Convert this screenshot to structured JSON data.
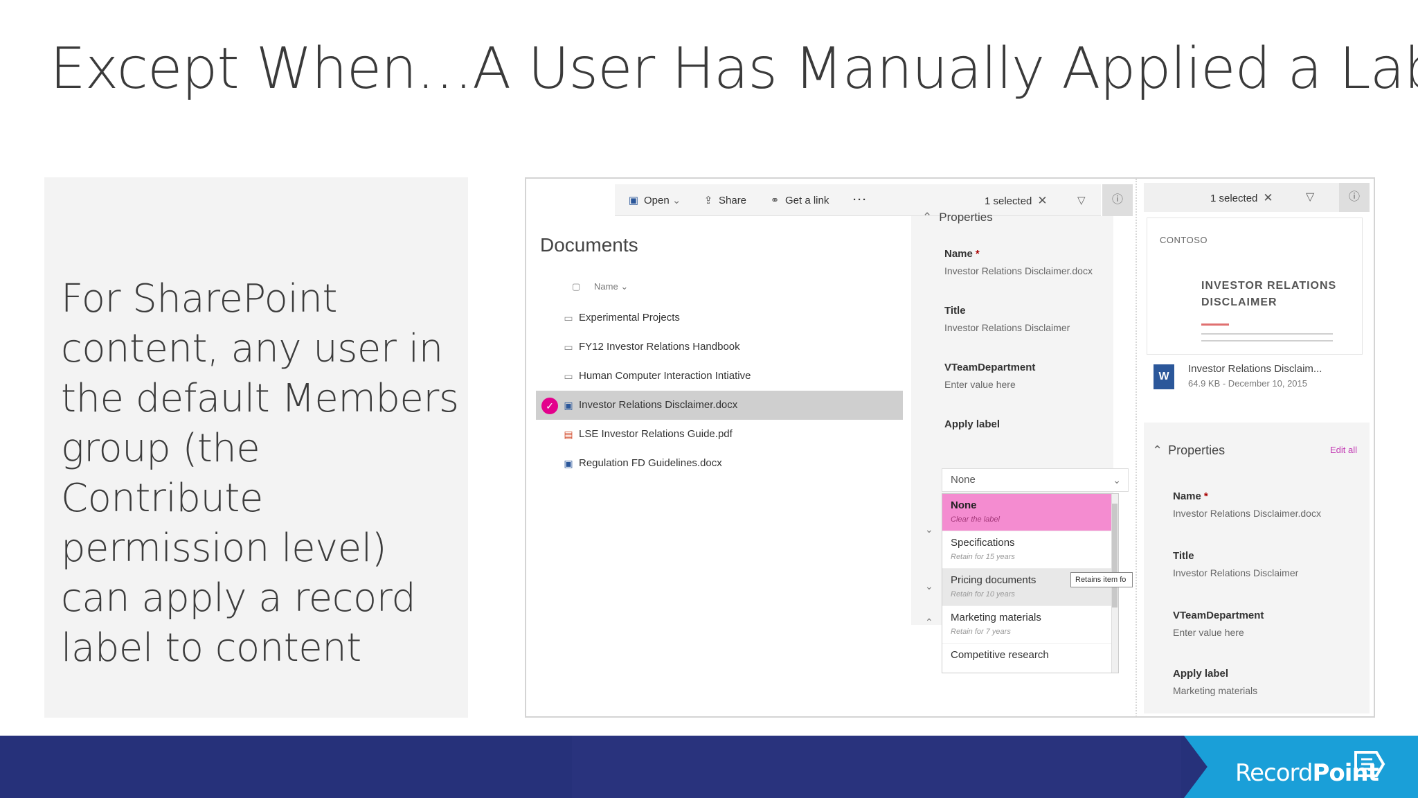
{
  "slide": {
    "title": "Except When…A User Has Manually Applied a Label",
    "body": "For SharePoint content, any user in the default Members group (the Contribute permission level) can apply a record label to content"
  },
  "library": {
    "commands": {
      "open": "Open",
      "share": "Share",
      "get_link": "Get a link",
      "more": "···",
      "selected": "1 selected"
    },
    "title": "Documents",
    "column_name": "Name",
    "rows": [
      {
        "name": "Experimental Projects",
        "kind": "folder"
      },
      {
        "name": "FY12 Investor Relations Handbook",
        "kind": "folder"
      },
      {
        "name": "Human Computer Interaction Intiative",
        "kind": "folder"
      },
      {
        "name": "Investor Relations Disclaimer.docx",
        "kind": "word",
        "selected": true
      },
      {
        "name": "LSE Investor Relations Guide.pdf",
        "kind": "pdf"
      },
      {
        "name": "Regulation FD Guidelines.docx",
        "kind": "word"
      }
    ]
  },
  "properties_pane": {
    "header": "Properties",
    "name_label": "Name",
    "name_value": "Investor Relations Disclaimer.docx",
    "title_label": "Title",
    "title_value": "Investor Relations Disclaimer",
    "dept_label": "VTeamDepartment",
    "dept_placeholder": "Enter value here",
    "apply_label": "Apply label",
    "apply_value": "None",
    "options": [
      {
        "title": "None",
        "sub": "Clear the label"
      },
      {
        "title": "Specifications",
        "sub": "Retain for 15 years"
      },
      {
        "title": "Pricing documents",
        "sub": "Retain for 10 years"
      },
      {
        "title": "Marketing materials",
        "sub": "Retain for 7 years"
      },
      {
        "title": "Competitive research",
        "sub": ""
      }
    ],
    "tooltip": "Retains item fo"
  },
  "details_pane": {
    "selected": "1 selected",
    "preview_brand": "CONTOSO",
    "preview_title_line1": "INVESTOR RELATIONS",
    "preview_title_line2": "DISCLAIMER",
    "file_name": "Investor Relations Disclaim...",
    "file_meta": "64.9 KB - December 10, 2015",
    "properties_header": "Properties",
    "edit_all": "Edit all",
    "name_label": "Name",
    "name_value": "Investor Relations Disclaimer.docx",
    "title_label": "Title",
    "title_value": "Investor Relations Disclaimer",
    "dept_label": "VTeamDepartment",
    "dept_placeholder": "Enter value here",
    "apply_label": "Apply label",
    "apply_value": "Marketing materials"
  },
  "footer": {
    "logo_regular": "Record",
    "logo_bold": "Point"
  },
  "colors": {
    "footer_bg": "#26317a",
    "logo_plate": "#1a9fd8",
    "selection_pink": "#e3008c",
    "active_option": "#f48cd0"
  }
}
